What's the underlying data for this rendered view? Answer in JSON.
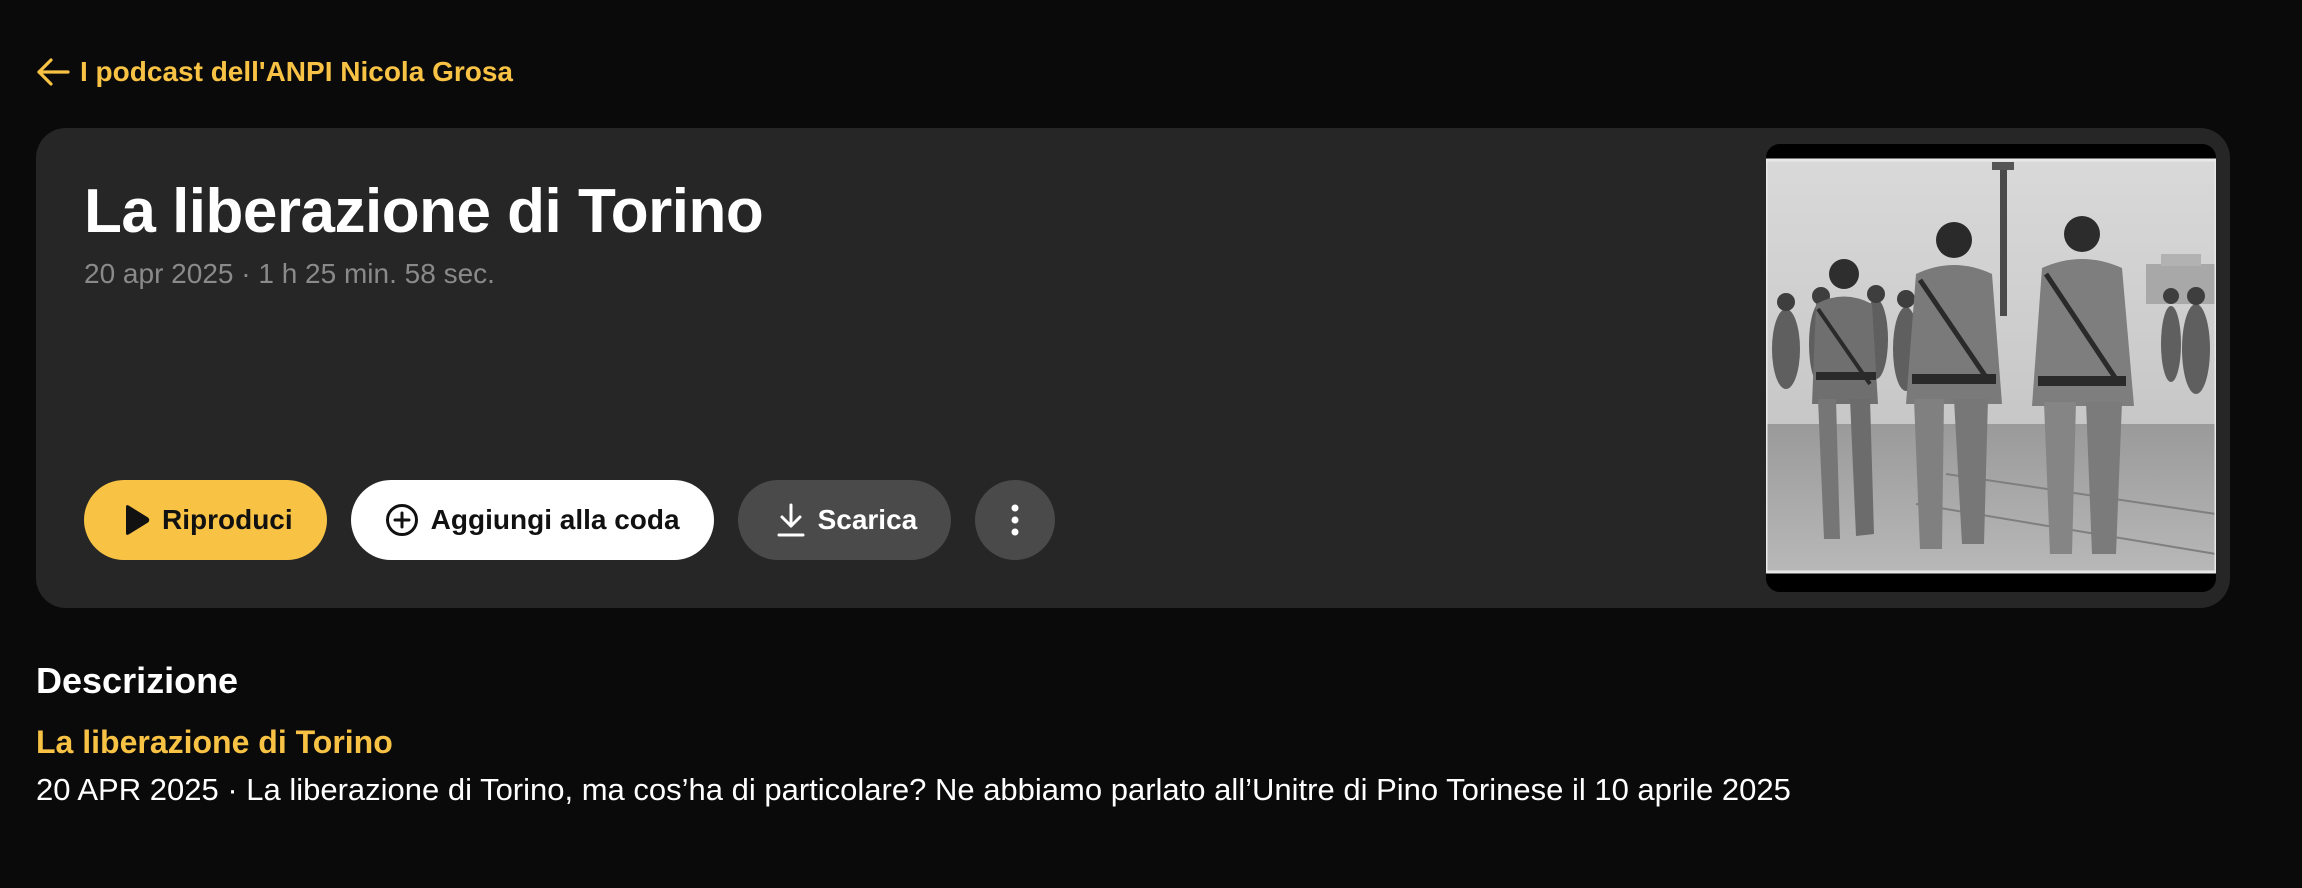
{
  "back": {
    "label": "I podcast dell'ANPI Nicola Grosa",
    "icon": "arrow-left-icon"
  },
  "episode": {
    "title": "La liberazione di Torino",
    "meta": "20 apr 2025 · 1 h 25 min. 58 sec.",
    "cover_icon": "episode-cover-photo"
  },
  "actions": {
    "play_label": "Riproduci",
    "queue_label": "Aggiungi alla coda",
    "download_label": "Scarica",
    "more_icon": "more-vertical-icon"
  },
  "description": {
    "heading": "Descrizione",
    "link_title": "La liberazione di Torino",
    "text": "20 APR 2025 · La liberazione di Torino, ma cos’ha di particolare? Ne abbiamo parlato all’Unitre di Pino Torinese il 10 aprile 2025"
  },
  "colors": {
    "accent": "#f8c244",
    "background": "#0a0a0a",
    "card": "#262626",
    "secondary_button": "#4a4a4a"
  }
}
